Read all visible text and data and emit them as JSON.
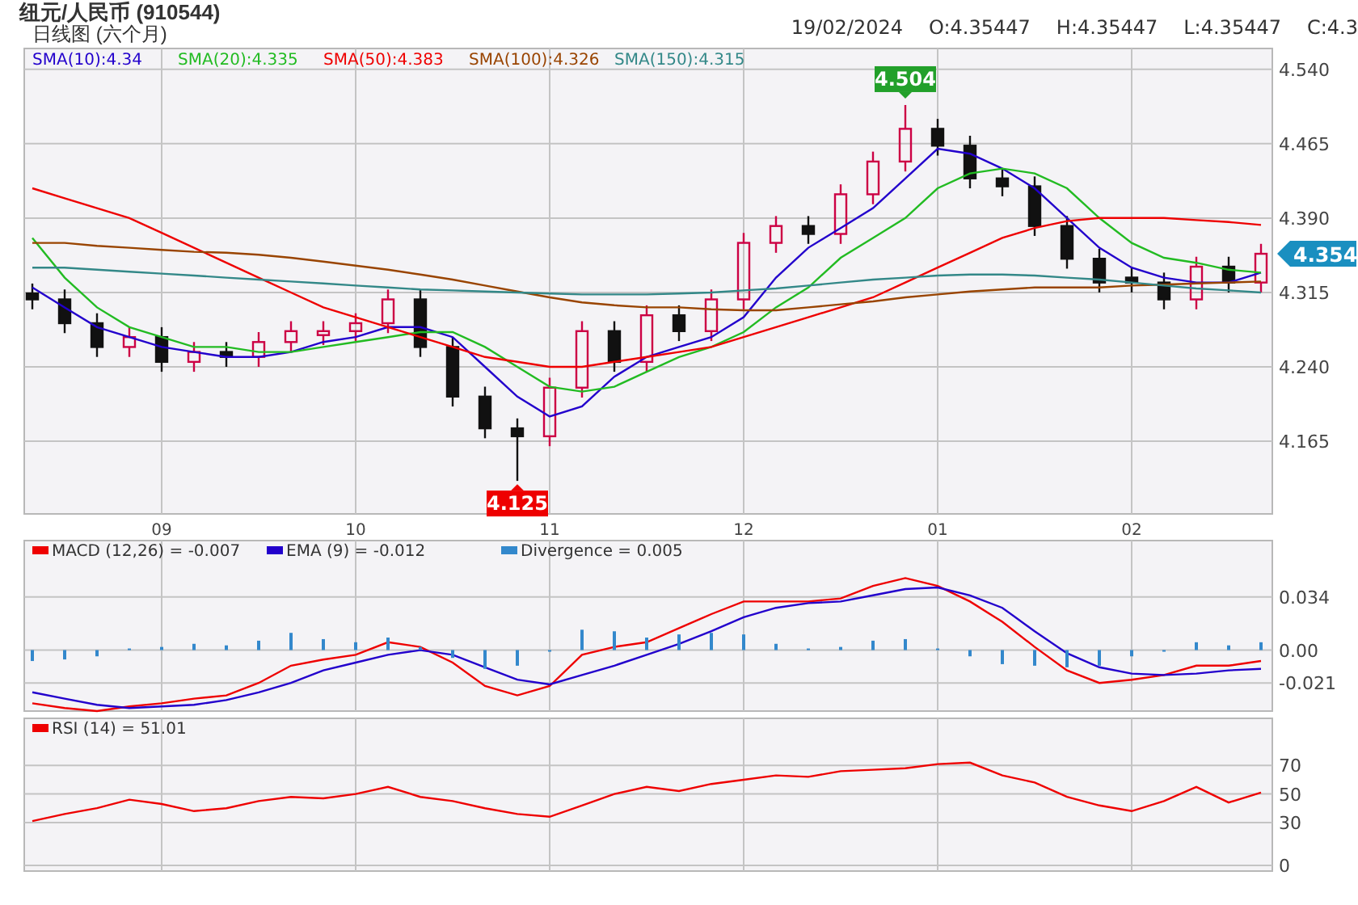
{
  "header": {
    "title": "纽元/人民币 (910544)",
    "subtitle": "日线图 (六个月)",
    "date": "19/02/2024",
    "ohlc": [
      "O:4.35447",
      "H:4.35447",
      "L:4.35447",
      "C:4.3"
    ]
  },
  "price_panel": {
    "last_price": "4.354",
    "chart_data": {
      "type": "candlestick",
      "grid": true,
      "legend": "top left",
      "categories": [
        null,
        null,
        null,
        null,
        "09",
        null,
        null,
        null,
        null,
        null,
        "10",
        null,
        null,
        null,
        null,
        null,
        "11",
        null,
        null,
        null,
        null,
        null,
        "12",
        null,
        null,
        null,
        null,
        null,
        "01",
        null,
        null,
        null,
        null,
        null,
        "02",
        null,
        null,
        null,
        null
      ],
      "ylim": [
        4.0917,
        4.561
      ],
      "yticks": [
        {
          "value": 4.54,
          "label": "4.540"
        },
        {
          "value": 4.465,
          "label": "4.465"
        },
        {
          "value": 4.39,
          "label": "4.390"
        },
        {
          "value": 4.315,
          "label": "4.315"
        },
        {
          "value": 4.24,
          "label": "4.240"
        },
        {
          "value": 4.165,
          "label": "4.165"
        }
      ],
      "ohlc": [
        [
          4.314,
          4.324,
          4.298,
          4.308
        ],
        [
          4.308,
          4.318,
          4.274,
          4.284
        ],
        [
          4.284,
          4.294,
          4.25,
          4.26
        ],
        [
          4.26,
          4.28,
          4.25,
          4.27
        ],
        [
          4.27,
          4.28,
          4.235,
          4.245
        ],
        [
          4.245,
          4.265,
          4.235,
          4.255
        ],
        [
          4.255,
          4.265,
          4.24,
          4.25
        ],
        [
          4.25,
          4.275,
          4.24,
          4.265
        ],
        [
          4.265,
          4.286,
          4.255,
          4.276
        ],
        [
          4.272,
          4.286,
          4.262,
          4.276
        ],
        [
          4.276,
          4.294,
          4.266,
          4.284
        ],
        [
          4.284,
          4.318,
          4.274,
          4.308
        ],
        [
          4.308,
          4.318,
          4.25,
          4.26
        ],
        [
          4.26,
          4.27,
          4.2,
          4.21
        ],
        [
          4.21,
          4.22,
          4.168,
          4.178
        ],
        [
          4.178,
          4.188,
          4.125,
          4.17
        ],
        [
          4.17,
          4.229,
          4.16,
          4.219
        ],
        [
          4.219,
          4.286,
          4.209,
          4.276
        ],
        [
          4.276,
          4.286,
          4.235,
          4.245
        ],
        [
          4.245,
          4.302,
          4.235,
          4.292
        ],
        [
          4.292,
          4.302,
          4.266,
          4.276
        ],
        [
          4.276,
          4.318,
          4.266,
          4.308
        ],
        [
          4.308,
          4.375,
          4.298,
          4.365
        ],
        [
          4.365,
          4.392,
          4.355,
          4.382
        ],
        [
          4.382,
          4.392,
          4.364,
          4.374
        ],
        [
          4.374,
          4.424,
          4.364,
          4.414
        ],
        [
          4.414,
          4.457,
          4.404,
          4.447
        ],
        [
          4.447,
          4.504,
          4.437,
          4.48
        ],
        [
          4.48,
          4.49,
          4.453,
          4.463
        ],
        [
          4.463,
          4.473,
          4.42,
          4.43
        ],
        [
          4.43,
          4.44,
          4.412,
          4.422
        ],
        [
          4.422,
          4.432,
          4.372,
          4.382
        ],
        [
          4.382,
          4.392,
          4.339,
          4.349
        ],
        [
          4.349,
          4.359,
          4.315,
          4.325
        ],
        [
          4.33,
          4.34,
          4.315,
          4.325
        ],
        [
          4.325,
          4.335,
          4.298,
          4.308
        ],
        [
          4.308,
          4.351,
          4.298,
          4.341
        ],
        [
          4.341,
          4.351,
          4.315,
          4.325
        ],
        [
          4.325,
          4.364,
          4.315,
          4.354
        ]
      ],
      "series": [
        {
          "type": "line",
          "name": "SMA(10):4.34",
          "color": "#2200cc",
          "values": [
            4.32,
            4.3,
            4.28,
            4.27,
            4.26,
            4.255,
            4.25,
            4.25,
            4.255,
            4.265,
            4.27,
            4.28,
            4.28,
            4.27,
            4.24,
            4.21,
            4.19,
            4.2,
            4.23,
            4.25,
            4.26,
            4.27,
            4.29,
            4.33,
            4.36,
            4.38,
            4.4,
            4.43,
            4.46,
            4.455,
            4.44,
            4.42,
            4.39,
            4.36,
            4.34,
            4.33,
            4.325,
            4.325,
            4.335
          ]
        },
        {
          "type": "line",
          "name": "SMA(20):4.335",
          "color": "#22bb22",
          "values": [
            4.37,
            4.33,
            4.3,
            4.28,
            4.27,
            4.26,
            4.26,
            4.255,
            4.255,
            4.26,
            4.265,
            4.27,
            4.275,
            4.275,
            4.26,
            4.24,
            4.22,
            4.215,
            4.22,
            4.235,
            4.25,
            4.26,
            4.275,
            4.3,
            4.32,
            4.35,
            4.37,
            4.39,
            4.42,
            4.435,
            4.44,
            4.435,
            4.42,
            4.39,
            4.365,
            4.35,
            4.345,
            4.338,
            4.335
          ]
        },
        {
          "type": "line",
          "name": "SMA(50):4.383",
          "color": "#ee0000",
          "values": [
            4.42,
            4.41,
            4.4,
            4.39,
            4.375,
            4.36,
            4.345,
            4.33,
            4.315,
            4.3,
            4.29,
            4.28,
            4.27,
            4.26,
            4.25,
            4.245,
            4.24,
            4.24,
            4.245,
            4.25,
            4.255,
            4.26,
            4.27,
            4.28,
            4.29,
            4.3,
            4.31,
            4.325,
            4.34,
            4.355,
            4.37,
            4.38,
            4.387,
            4.39,
            4.39,
            4.39,
            4.388,
            4.386,
            4.383
          ]
        },
        {
          "type": "line",
          "name": "SMA(100):4.326",
          "color": "#994400",
          "values": [
            4.365,
            4.365,
            4.362,
            4.36,
            4.358,
            4.356,
            4.355,
            4.353,
            4.35,
            4.346,
            4.342,
            4.338,
            4.333,
            4.328,
            4.322,
            4.316,
            4.31,
            4.305,
            4.302,
            4.3,
            4.3,
            4.298,
            4.297,
            4.297,
            4.3,
            4.303,
            4.306,
            4.31,
            4.313,
            4.316,
            4.318,
            4.32,
            4.32,
            4.32,
            4.322,
            4.323,
            4.324,
            4.325,
            4.326
          ]
        },
        {
          "type": "line",
          "name": "SMA(150):4.315",
          "color": "#338888",
          "values": [
            4.34,
            4.34,
            4.338,
            4.336,
            4.334,
            4.332,
            4.33,
            4.328,
            4.326,
            4.324,
            4.322,
            4.32,
            4.318,
            4.317,
            4.316,
            4.315,
            4.314,
            4.313,
            4.313,
            4.313,
            4.314,
            4.315,
            4.317,
            4.319,
            4.322,
            4.325,
            4.328,
            4.33,
            4.332,
            4.333,
            4.333,
            4.332,
            4.33,
            4.328,
            4.325,
            4.322,
            4.319,
            4.317,
            4.315
          ]
        }
      ],
      "annotations": [
        {
          "text": "4.504",
          "y": 4.504
        },
        {
          "text": "4.125",
          "y": 4.125
        }
      ]
    }
  },
  "macd_panel": {
    "chart_data": {
      "type": "line",
      "grid": true,
      "legend": "top left",
      "ylim": [
        -0.039,
        0.07
      ],
      "yticks": [
        {
          "value": 0.034,
          "label": "0.034"
        },
        {
          "value": 0,
          "label": "0.00"
        },
        {
          "value": -0.021,
          "label": "-0.021"
        }
      ],
      "series": [
        {
          "name": "MACD (12,26) = -0.007",
          "color": "#ee0000",
          "values": [
            -0.034,
            -0.037,
            -0.039,
            -0.036,
            -0.034,
            -0.031,
            -0.029,
            -0.021,
            -0.01,
            -0.006,
            -0.003,
            0.005,
            0.002,
            -0.008,
            -0.023,
            -0.029,
            -0.023,
            -0.003,
            0.002,
            0.005,
            0.014,
            0.023,
            0.031,
            0.031,
            0.031,
            0.033,
            0.041,
            0.046,
            0.041,
            0.031,
            0.018,
            0.002,
            -0.013,
            -0.021,
            -0.019,
            -0.016,
            -0.01,
            -0.01,
            -0.007
          ]
        },
        {
          "name": "EMA (9) = -0.012",
          "color": "#2200cc",
          "values": [
            -0.027,
            -0.031,
            -0.035,
            -0.037,
            -0.036,
            -0.035,
            -0.032,
            -0.027,
            -0.021,
            -0.013,
            -0.008,
            -0.003,
            0,
            -0.003,
            -0.011,
            -0.019,
            -0.022,
            -0.016,
            -0.01,
            -0.003,
            0.004,
            0.012,
            0.021,
            0.027,
            0.03,
            0.031,
            0.035,
            0.039,
            0.04,
            0.035,
            0.027,
            0.012,
            -0.002,
            -0.011,
            -0.015,
            -0.016,
            -0.015,
            -0.013,
            -0.012
          ]
        },
        {
          "type": "bar",
          "name": "Divergence = 0.005",
          "color": "#3388cc",
          "values": [
            -0.007,
            -0.006,
            -0.004,
            0.001,
            0.002,
            0.004,
            0.003,
            0.006,
            0.011,
            0.007,
            0.005,
            0.008,
            0.002,
            -0.005,
            -0.012,
            -0.01,
            -0.001,
            0.013,
            0.012,
            0.008,
            0.01,
            0.011,
            0.01,
            0.004,
            0.001,
            0.002,
            0.006,
            0.007,
            0.001,
            -0.004,
            -0.009,
            -0.01,
            -0.011,
            -0.01,
            -0.004,
            0,
            0.005,
            0.003,
            0.005
          ]
        }
      ]
    }
  },
  "rsi_panel": {
    "chart_data": {
      "type": "line",
      "grid": true,
      "legend": "top left",
      "ylim": [
        -4,
        103
      ],
      "yticks": [
        {
          "value": 70,
          "label": "70"
        },
        {
          "value": 50,
          "label": "50"
        },
        {
          "value": 30,
          "label": "30"
        },
        {
          "value": 0,
          "label": "0"
        }
      ],
      "series": [
        {
          "name": "RSI (14)  = 51.01",
          "color": "#ee0000",
          "values": [
            31,
            36,
            40,
            46,
            43,
            38,
            40,
            45,
            48,
            47,
            50,
            55,
            48,
            45,
            40,
            36,
            34,
            42,
            50,
            55,
            52,
            57,
            60,
            63,
            62,
            66,
            67,
            68,
            71,
            72,
            63,
            58,
            48,
            42,
            38,
            45,
            55,
            44,
            51
          ]
        }
      ]
    }
  }
}
